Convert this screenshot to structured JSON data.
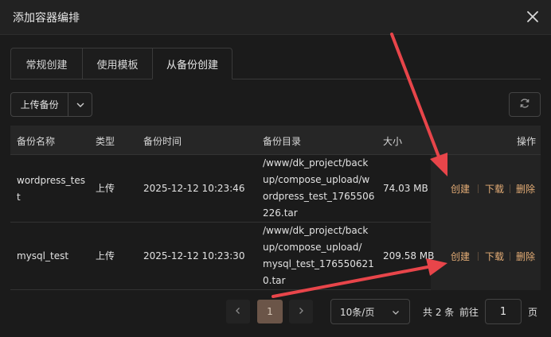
{
  "dialog": {
    "title": "添加容器编排"
  },
  "tabs": [
    {
      "label": "常规创建",
      "active": false
    },
    {
      "label": "使用模板",
      "active": false
    },
    {
      "label": "从备份创建",
      "active": true
    }
  ],
  "toolbar": {
    "upload_label": "上传备份"
  },
  "table": {
    "columns": [
      "备份名称",
      "类型",
      "备份时间",
      "备份目录",
      "大小",
      "操作"
    ],
    "rows": [
      {
        "name_lines": [
          "wordpress_tes",
          "t"
        ],
        "type": "上传",
        "time": "2025-12-12 10:23:46",
        "dir_lines": [
          "/www/dk_project/back",
          "up/compose_upload/w",
          "ordpress_test_1765506",
          "226.tar"
        ],
        "size": "74.03 MB",
        "ops": [
          "创建",
          "下载",
          "删除"
        ]
      },
      {
        "name_lines": [
          "mysql_test"
        ],
        "type": "上传",
        "time": "2025-12-12 10:23:30",
        "dir_lines": [
          "/www/dk_project/back",
          "up/compose_upload/",
          "mysql_test_176550621",
          "0.tar"
        ],
        "size": "209.58 MB",
        "ops": [
          "创建",
          "下载",
          "删除"
        ]
      }
    ]
  },
  "pagination": {
    "current_page": "1",
    "page_size": "10条/页",
    "total_text": "共 2 条",
    "goto_label": "前往",
    "goto_value": "1",
    "page_suffix": "页"
  },
  "colors": {
    "accent": "#e5ad76",
    "annotation_arrow": "#e8454a",
    "active_page": "#6b5548"
  }
}
